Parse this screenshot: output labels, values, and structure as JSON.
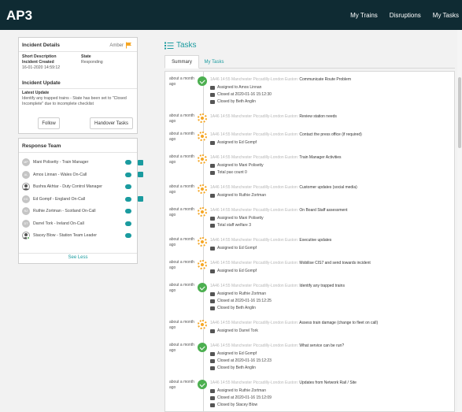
{
  "nav": {
    "logo_text": "AP3",
    "links": [
      "My Trains",
      "Disruptions",
      "My Tasks"
    ]
  },
  "incident": {
    "title": "Incident Details",
    "level": "Amber",
    "short_description_label": "Short Description",
    "state_label": "State",
    "short_description_value": "Incident Created",
    "state_value": "Responding",
    "created_at": "16-01-2020 14:59:12",
    "update_title": "Incident Update",
    "latest_update_label": "Latest Update",
    "latest_update_text": "Identify any trapped trains - State has been set to \"Closed Incomplete\" due to incomplete checklist",
    "follow_label": "Follow",
    "handover_label": "Handover Tasks"
  },
  "team": {
    "title": "Response Team",
    "members": [
      {
        "initials": "MP",
        "name": "Mani Polisetty - Train Manager",
        "chat": true,
        "phone": true,
        "photo": false
      },
      {
        "initials": "AL",
        "name": "Amos Linnan - Wales On-Call",
        "chat": true,
        "phone": true,
        "photo": false
      },
      {
        "initials": "",
        "name": "Bushra Akhtar - Duty Control Manager",
        "chat": true,
        "phone": false,
        "photo": true
      },
      {
        "initials": "EG",
        "name": "Ed Gompf - England On-Call",
        "chat": true,
        "phone": true,
        "photo": false
      },
      {
        "initials": "RZ",
        "name": "Ruthie Zortman - Scotland On-Call",
        "chat": true,
        "phone": false,
        "photo": false
      },
      {
        "initials": "DT",
        "name": "Darrel Tork - Ireland On-Call",
        "chat": true,
        "phone": false,
        "photo": false
      },
      {
        "initials": "",
        "name": "Stacey Blow - Station Team Leader",
        "chat": true,
        "phone": false,
        "photo": true
      }
    ],
    "see_less_label": "See Less"
  },
  "tasks": {
    "title": "Tasks",
    "tabs": [
      "Summary",
      "My Tasks"
    ],
    "items": [
      {
        "ago": "about a month ago",
        "status": "done",
        "meta": "1A46 14:55 Manchester Piccadilly-London Euston:",
        "title": "Communicate Route Problem",
        "details": [
          {
            "icon": "briefcase-icon",
            "text": "Assigned to Amos Linnan"
          },
          {
            "icon": "calendar-check-icon",
            "text": "Closed at 2020-01-16 15:12:30"
          },
          {
            "icon": "users-icon",
            "text": "Closed by Beth Anglin"
          }
        ]
      },
      {
        "ago": "about a month ago",
        "status": "pending",
        "meta": "1A46 14:55 Manchester Piccadilly-London Euston:",
        "title": "Review station needs",
        "details": []
      },
      {
        "ago": "about a month ago",
        "status": "pending",
        "meta": "1A46 14:55 Manchester Piccadilly-London Euston:",
        "title": "Contact the press office (if required)",
        "details": [
          {
            "icon": "briefcase-icon",
            "text": "Assigned to Ed Gompf"
          }
        ]
      },
      {
        "ago": "about a month ago",
        "status": "pending",
        "meta": "1A46 14:55 Manchester Piccadilly-London Euston:",
        "title": "Train Manager Activities",
        "details": [
          {
            "icon": "briefcase-icon",
            "text": "Assigned to Mani Polisetty"
          },
          {
            "icon": "person-icon",
            "text": "Total pax count 0"
          }
        ]
      },
      {
        "ago": "about a month ago",
        "status": "pending",
        "meta": "1A46 14:55 Manchester Piccadilly-London Euston:",
        "title": "Customer updates (social media)",
        "details": [
          {
            "icon": "briefcase-icon",
            "text": "Assigned to Ruthie Zortman"
          }
        ]
      },
      {
        "ago": "about a month ago",
        "status": "pending",
        "meta": "1A46 14:55 Manchester Piccadilly-London Euston:",
        "title": "On Board Staff assessment",
        "details": [
          {
            "icon": "briefcase-icon",
            "text": "Assigned to Mani Polisetty"
          },
          {
            "icon": "document-icon",
            "text": "Total staff welfare 3"
          }
        ]
      },
      {
        "ago": "about a month ago",
        "status": "pending",
        "meta": "1A46 14:55 Manchester Piccadilly-London Euston:",
        "title": "Executive updates",
        "details": [
          {
            "icon": "briefcase-icon",
            "text": "Assigned to Ed Gompf"
          }
        ]
      },
      {
        "ago": "about a month ago",
        "status": "pending",
        "meta": "1A46 14:55 Manchester Piccadilly-London Euston:",
        "title": "Mobilise CIS7 and send towards incident",
        "details": [
          {
            "icon": "briefcase-icon",
            "text": "Assigned to Ed Gompf"
          }
        ]
      },
      {
        "ago": "about a month ago",
        "status": "done",
        "meta": "1A46 14:55 Manchester Piccadilly-London Euston:",
        "title": "Identify any trapped trains",
        "details": [
          {
            "icon": "briefcase-icon",
            "text": "Assigned to Ruthie Zortman"
          },
          {
            "icon": "calendar-check-icon",
            "text": "Closed at 2020-01-16 15:12:25"
          },
          {
            "icon": "users-icon",
            "text": "Closed by Beth Anglin"
          }
        ]
      },
      {
        "ago": "about a month ago",
        "status": "pending",
        "meta": "1A46 14:55 Manchester Piccadilly-London Euston:",
        "title": "Assess train damage (change to fleet on call)",
        "details": [
          {
            "icon": "briefcase-icon",
            "text": "Assigned to Darrel Tork"
          }
        ]
      },
      {
        "ago": "about a month ago",
        "status": "done",
        "meta": "1A46 14:55 Manchester Piccadilly-London Euston:",
        "title": "What service can be run?",
        "details": [
          {
            "icon": "briefcase-icon",
            "text": "Assigned to Ed Gompf"
          },
          {
            "icon": "calendar-check-icon",
            "text": "Closed at 2020-01-16 15:12:23"
          },
          {
            "icon": "users-icon",
            "text": "Closed by Beth Anglin"
          }
        ]
      },
      {
        "ago": "about a month ago",
        "status": "done",
        "meta": "1A46 14:55 Manchester Piccadilly-London Euston:",
        "title": "Updates from Network Rail / Site",
        "details": [
          {
            "icon": "briefcase-icon",
            "text": "Assigned to Ruthie Zortman"
          },
          {
            "icon": "calendar-check-icon",
            "text": "Closed at 2020-01-16 15:12:09"
          },
          {
            "icon": "users-icon",
            "text": "Closed by Stacey Blow"
          }
        ]
      }
    ]
  },
  "colors": {
    "nav_bg": "#0f2b33",
    "accent": "#1a9b9f",
    "amber": "#f5a623",
    "done": "#4caf50"
  }
}
